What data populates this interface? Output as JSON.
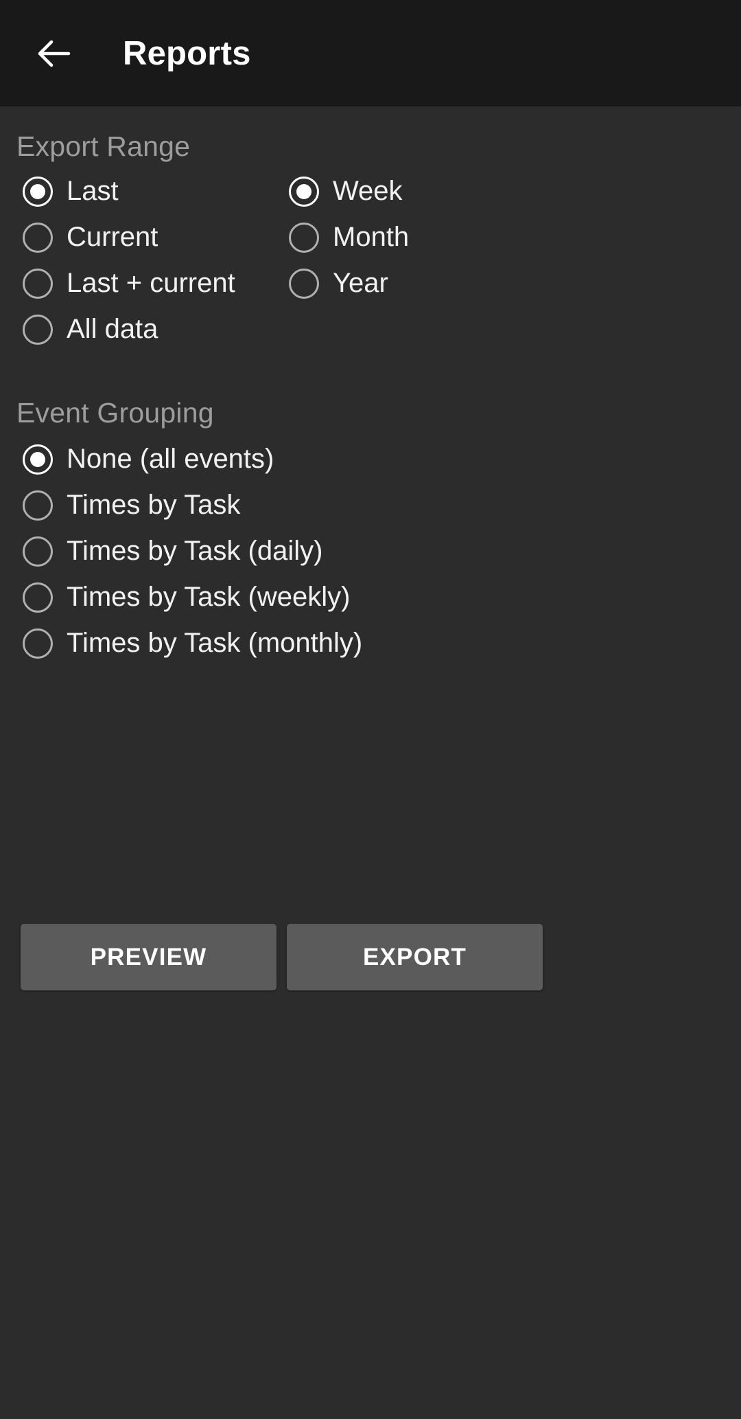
{
  "appbar": {
    "back_icon": "arrow-left-icon",
    "title": "Reports"
  },
  "export_range": {
    "title": "Export Range",
    "left_options": [
      {
        "label": "Last",
        "selected": true
      },
      {
        "label": "Current",
        "selected": false
      },
      {
        "label": "Last + current",
        "selected": false
      },
      {
        "label": "All data",
        "selected": false
      }
    ],
    "right_options": [
      {
        "label": "Week",
        "selected": true
      },
      {
        "label": "Month",
        "selected": false
      },
      {
        "label": "Year",
        "selected": false
      }
    ]
  },
  "event_grouping": {
    "title": "Event Grouping",
    "options": [
      {
        "label": "None (all events)",
        "selected": true
      },
      {
        "label": "Times by Task",
        "selected": false
      },
      {
        "label": "Times by Task (daily)",
        "selected": false
      },
      {
        "label": "Times by Task (weekly)",
        "selected": false
      },
      {
        "label": "Times by Task (monthly)",
        "selected": false
      }
    ]
  },
  "actions": {
    "preview_label": "PREVIEW",
    "export_label": "EXPORT"
  },
  "colors": {
    "appbar_background": "#191919",
    "page_background": "#2c2c2c",
    "section_title": "#9d9d9d",
    "label_text": "#f2f2f2",
    "radio_unselected": "#b0b0b0",
    "radio_selected": "#ffffff",
    "button_background": "#5b5b5b",
    "button_text": "#ffffff"
  }
}
